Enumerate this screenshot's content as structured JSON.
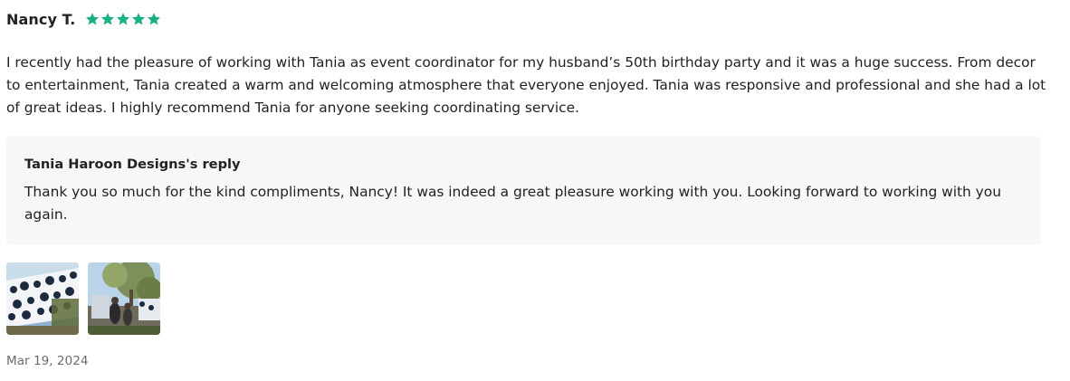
{
  "review": {
    "reviewer_name": "Nancy T.",
    "rating": 5,
    "rating_max": 5,
    "star_color": "#19b087",
    "body": "I recently had the pleasure of working with Tania as event coordinator for my husband’s 50th birthday party and it was a huge success. From decor to entertainment, Tania created a warm and welcoming atmosphere that everyone enjoyed. Tania was responsive and professional and she had a lot of great ideas. I highly recommend Tania for anyone seeking coordinating service.",
    "reply": {
      "title": "Tania Haroon Designs's reply",
      "body": "Thank you so much for the kind compliments, Nancy! It was indeed a great pleasure working with you. Looking forward to working with you again."
    },
    "photos": [
      {
        "icon": "review-photo-decor"
      },
      {
        "icon": "review-photo-party"
      }
    ],
    "date": "Mar 19, 2024"
  },
  "colors": {
    "text": "#222222",
    "muted_text": "#6b6b6b",
    "reply_background": "#f7f7f7"
  }
}
